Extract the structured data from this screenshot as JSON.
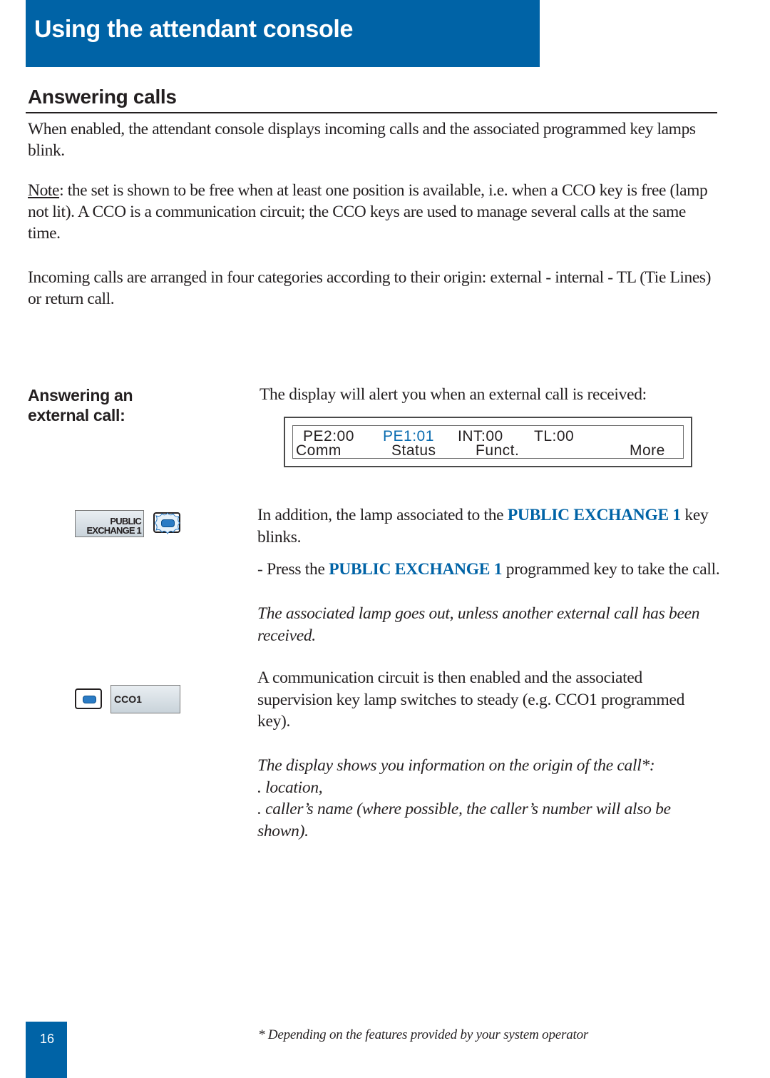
{
  "header": {
    "title": "Using the attendant console",
    "band_color": "#0063a6"
  },
  "section": {
    "title": "Answering calls"
  },
  "intro": {
    "p1": "When enabled, the attendant console displays incoming calls and the associated programmed key lamps blink.",
    "p2_label": "Note",
    "p2_text": ": the set is shown to be free when at least one position is available, i.e. when a CCO key is free (lamp not lit). A CCO is a communication circuit; the CCO keys are used to manage several calls at the same time.",
    "p3": "Incoming calls are arranged in four categories according to their origin: external - internal - TL (Tie Lines) or return call."
  },
  "external_call": {
    "subtitle": "Answering an external call:",
    "alert_text": "The display will alert you when an external call is received:",
    "display": {
      "row1": [
        "PE2:00",
        "PE1:01",
        "INT:00",
        "TL:00"
      ],
      "highlighted": "PE1:01",
      "row2": [
        "Comm",
        "Status",
        "Funct.",
        "More"
      ]
    },
    "lamp_text_pre": "In addition, the lamp associated to the ",
    "key_name": "PUBLIC EXCHANGE 1",
    "lamp_text_post": " key blinks.",
    "press_pre": "- Press the ",
    "press_post": " programmed key to take the call.",
    "press_note": "The associated lamp goes out, unless another external call has been received.",
    "cco_text": "A communication circuit is then enabled and the associated supervision key lamp switches to steady (e.g. CCO1 programmed key).",
    "origin_intro": "The display shows you information on the origin of the call*:",
    "origin_items": [
      ". location,",
      ". caller’s name (where possible, the caller’s number will also be shown)."
    ]
  },
  "keys": {
    "public_exchange_line1": "PUBLIC",
    "public_exchange_line2": "EXCHANGE 1",
    "public_exchange_lamp": "blinking",
    "cco_label": "CCO1",
    "cco_lamp": "steady"
  },
  "footer": {
    "page_number": "16",
    "footnote": "* Depending on the features provided by your system operator"
  },
  "colors": {
    "accent_blue": "#0063a6",
    "lamp_blue": "#2b7bc4"
  }
}
